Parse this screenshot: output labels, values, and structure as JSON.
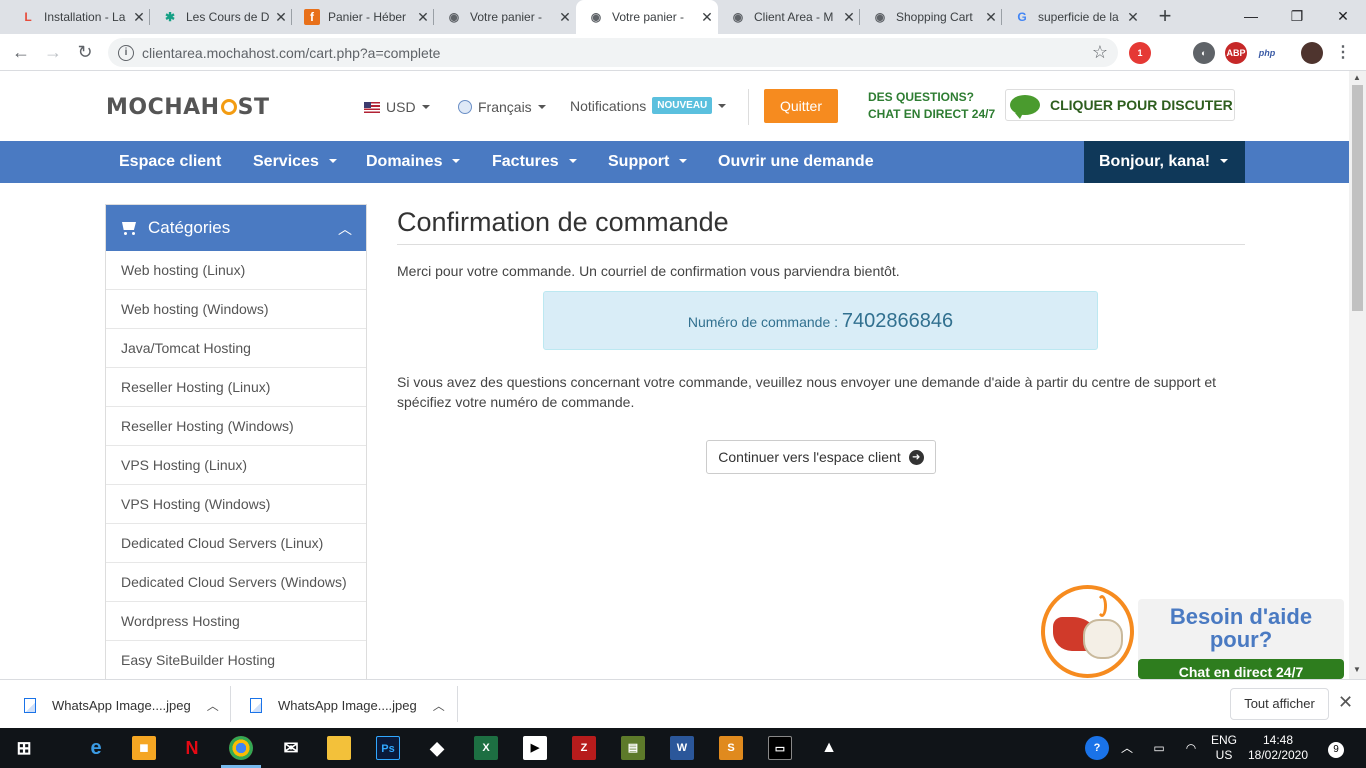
{
  "browser": {
    "tabs": [
      {
        "title": "Installation - La",
        "fav": "L",
        "color": "#e74c3c"
      },
      {
        "title": "Les Cours de D",
        "fav": "✱",
        "color": "#16a085"
      },
      {
        "title": "Panier - Héber",
        "fav": "f",
        "color": "#e8701a"
      },
      {
        "title": "Votre panier - ",
        "fav": "◉",
        "color": "#5f6368"
      },
      {
        "title": "Votre panier - ",
        "fav": "◉",
        "color": "#5f6368"
      },
      {
        "title": "Client Area - M",
        "fav": "◉",
        "color": "#5f6368"
      },
      {
        "title": "Shopping Cart",
        "fav": "◉",
        "color": "#5f6368"
      },
      {
        "title": "superficie de la",
        "fav": "G",
        "color": "#4285f4"
      }
    ],
    "url": "clientarea.mochahost.com/cart.php?a=complete",
    "ext_badge": "1",
    "php_label": "php"
  },
  "header": {
    "logo_a": "MOCHAH",
    "logo_b": "ST",
    "currency": "USD",
    "language": "Français",
    "notifications": "Notifications",
    "notif_badge": "NOUVEAU",
    "quit": "Quitter",
    "questions_l1": "DES QUESTIONS?",
    "questions_l2": "CHAT EN DIRECT 24/7",
    "chat_btn": "CLIQUER POUR DISCUTER"
  },
  "nav": {
    "items": [
      "Espace client",
      "Services",
      "Domaines",
      "Factures",
      "Support",
      "Ouvrir une demande"
    ],
    "greeting": "Bonjour, kana!"
  },
  "sidebar": {
    "title": "Catégories",
    "items": [
      "Web hosting (Linux)",
      "Web hosting (Windows)",
      "Java/Tomcat Hosting",
      "Reseller Hosting (Linux)",
      "Reseller Hosting (Windows)",
      "VPS Hosting (Linux)",
      "VPS Hosting (Windows)",
      "Dedicated Cloud Servers (Linux)",
      "Dedicated Cloud Servers (Windows)",
      "Wordpress Hosting",
      "Easy SiteBuilder Hosting"
    ]
  },
  "content": {
    "title": "Confirmation de commande",
    "thanks": "Merci pour votre commande. Un courriel de confirmation vous parviendra bientôt.",
    "order_label": "Numéro de commande : ",
    "order_number": "7402866846",
    "support_text": "Si vous avez des questions concernant votre commande, veuillez nous envoyer une demande d'aide à partir du centre de support et spécifiez votre numéro de commande.",
    "continue": "Continuer vers l'espace client"
  },
  "help": {
    "title": "Besoin d'aide pour?",
    "chat": "Chat en direct 24/7"
  },
  "downloads": {
    "items": [
      "WhatsApp Image....jpeg",
      "WhatsApp Image....jpeg"
    ],
    "show_all": "Tout afficher"
  },
  "taskbar": {
    "lang": "ENG",
    "region": "US",
    "time": "14:48",
    "date": "18/02/2020",
    "notif_count": "9"
  }
}
